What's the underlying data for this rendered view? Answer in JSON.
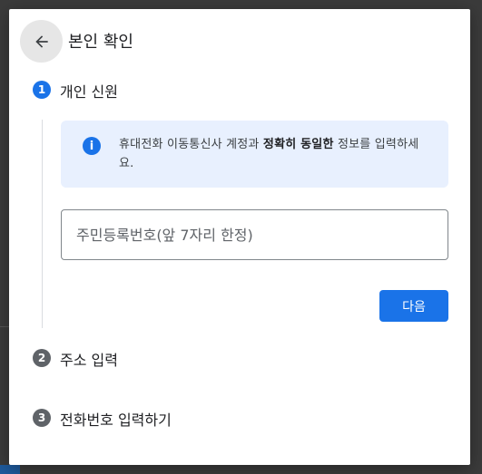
{
  "dialog": {
    "title": "본인 확인",
    "back_icon": "arrow-left-icon"
  },
  "steps": [
    {
      "number": "1",
      "label": "개인 신원",
      "state": "active"
    },
    {
      "number": "2",
      "label": "주소 입력",
      "state": "inactive"
    },
    {
      "number": "3",
      "label": "전화번호 입력하기",
      "state": "inactive"
    }
  ],
  "info": {
    "icon": "info-icon",
    "text_before": "휴대전화 이동통신사 계정과 ",
    "text_bold": "정확히 동일한",
    "text_after": " 정보를 입력하세요."
  },
  "rrn_input": {
    "placeholder": "주민등록번호(앞 7자리 한정)",
    "value": ""
  },
  "next_button": {
    "label": "다음"
  },
  "colors": {
    "accent": "#1a73e8",
    "info_bg": "#e8f0fe",
    "inactive_step": "#5f6368"
  }
}
